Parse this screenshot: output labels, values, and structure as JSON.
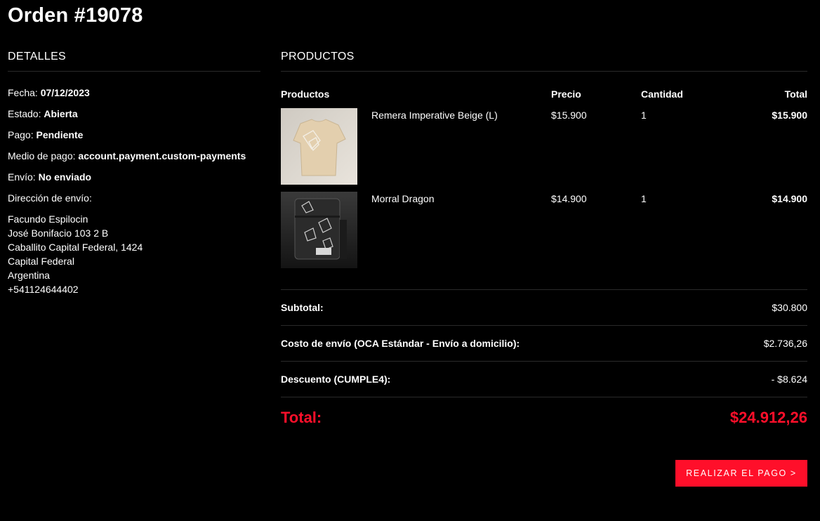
{
  "order": {
    "title": "Orden #19078"
  },
  "details": {
    "heading": "DETALLES",
    "fecha_label": "Fecha:",
    "fecha_value": "07/12/2023",
    "estado_label": "Estado:",
    "estado_value": "Abierta",
    "pago_label": "Pago:",
    "pago_value": "Pendiente",
    "medio_label": "Medio de pago:",
    "medio_value": "account.payment.custom-payments",
    "envio_label": "Envío:",
    "envio_value": "No enviado",
    "direccion_label": "Dirección de envío:",
    "address": {
      "line1": "Facundo Espilocin",
      "line2": "José Bonifacio 103 2 B",
      "line3": "Caballito Capital Federal, 1424",
      "line4": "Capital Federal",
      "line5": "Argentina",
      "line6": "+541124644402"
    }
  },
  "products": {
    "heading": "PRODUCTOS",
    "columns": {
      "product": "Productos",
      "price": "Precio",
      "qty": "Cantidad",
      "total": "Total"
    },
    "items": [
      {
        "name": "Remera Imperative Beige (L)",
        "price": "$15.900",
        "qty": "1",
        "total": "$15.900",
        "image_icon": "tshirt-image"
      },
      {
        "name": "Morral Dragon",
        "price": "$14.900",
        "qty": "1",
        "total": "$14.900",
        "image_icon": "bag-image"
      }
    ]
  },
  "summary": {
    "subtotal_label": "Subtotal:",
    "subtotal_value": "$30.800",
    "shipping_label": "Costo de envío (OCA Estándar - Envío a domicilio):",
    "shipping_value": "$2.736,26",
    "discount_label": "Descuento (CUMPLE4):",
    "discount_value": "- $8.624",
    "total_label": "Total:",
    "total_value": "$24.912,26"
  },
  "actions": {
    "pay_label": "REALIZAR EL PAGO >"
  },
  "colors": {
    "background": "#000000",
    "accent": "#ff0f2a",
    "text": "#ffffff"
  }
}
